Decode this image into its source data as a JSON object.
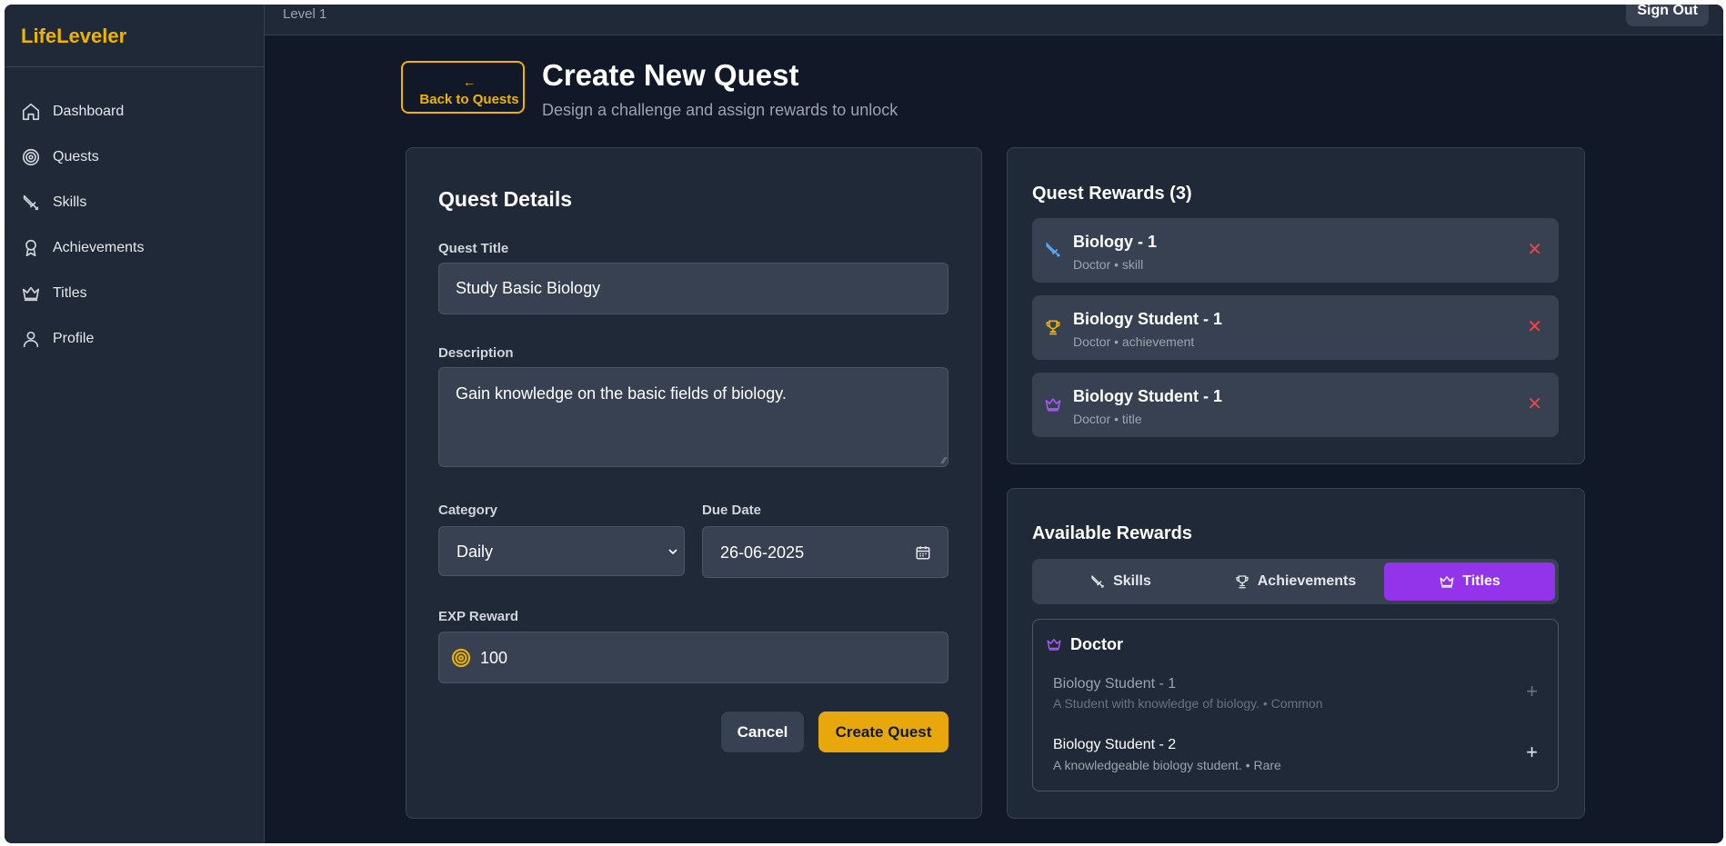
{
  "app": {
    "brand": "LifeLeveler"
  },
  "sidebar": {
    "items": [
      {
        "label": "Dashboard",
        "icon": "home-icon"
      },
      {
        "label": "Quests",
        "icon": "target-icon"
      },
      {
        "label": "Skills",
        "icon": "sword-icon"
      },
      {
        "label": "Achievements",
        "icon": "badge-icon"
      },
      {
        "label": "Titles",
        "icon": "crown-icon"
      },
      {
        "label": "Profile",
        "icon": "user-icon"
      }
    ]
  },
  "topbar": {
    "level": "Level 1",
    "signout_label": "Sign Out"
  },
  "header": {
    "back_label": "Back to Quests",
    "title": "Create New Quest",
    "subtitle": "Design a challenge and assign rewards to unlock"
  },
  "form": {
    "section_title": "Quest Details",
    "title_label": "Quest Title",
    "title_value": "Study Basic Biology",
    "description_label": "Description",
    "description_value": "Gain knowledge on the basic fields of biology.",
    "category_label": "Category",
    "category_value": "Daily",
    "due_label": "Due Date",
    "due_value": "26-06-2025",
    "exp_label": "EXP Reward",
    "exp_value": "100",
    "cancel_label": "Cancel",
    "create_label": "Create Quest"
  },
  "rewards": {
    "title": "Quest Rewards (3)",
    "items": [
      {
        "name": "Biology - 1",
        "sub": "Doctor • skill",
        "icon": "sword-icon"
      },
      {
        "name": "Biology Student - 1",
        "sub": "Doctor • achievement",
        "icon": "trophy-icon"
      },
      {
        "name": "Biology Student - 1",
        "sub": "Doctor • title",
        "icon": "crown-icon"
      }
    ]
  },
  "available": {
    "title": "Available Rewards",
    "tabs": [
      {
        "label": "Skills",
        "icon": "sword-icon"
      },
      {
        "label": "Achievements",
        "icon": "trophy-icon"
      },
      {
        "label": "Titles",
        "icon": "crown-icon"
      }
    ],
    "active_tab": "Titles",
    "group": "Doctor",
    "items": [
      {
        "name": "Biology Student - 1",
        "desc": "A Student with knowledge of biology. • Common",
        "added": true
      },
      {
        "name": "Biology Student - 2",
        "desc": "A knowledgeable biology student. • Rare",
        "added": false
      }
    ]
  },
  "colors": {
    "accent": "#f0b400",
    "purple": "#9333ea",
    "danger": "#ef4444",
    "background": "#111827",
    "panel": "#1f2937"
  }
}
